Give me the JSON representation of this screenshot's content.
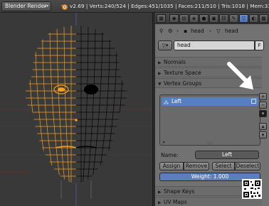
{
  "topbar": {
    "render_engine": "Blender Render",
    "stats": "v2.69 | Verts:240/524 | Edges:451/1035 | Faces:211/510 | Tris:1018 | Mem:33.02M (0.0"
  },
  "props_header": {
    "tabs": [
      "camera-tab",
      "world-tab",
      "object-tab",
      "constraints-tab",
      "modifiers-tab",
      "data-tab",
      "material-tab",
      "texture-tab",
      "particles-tab",
      "physics-tab"
    ]
  },
  "breadcrumb": {
    "object": "head",
    "mesh": "head"
  },
  "mesh_name": {
    "value": "head",
    "fake_user": "F"
  },
  "panels": {
    "normals": "Normals",
    "texture_space": "Texture Space",
    "vertex_groups": "Vertex Groups",
    "shape_keys": "Shape Keys",
    "uv_maps": "UV Maps"
  },
  "vertex_groups": {
    "items": [
      {
        "name": "Left",
        "selected": true
      }
    ]
  },
  "name_row": {
    "label": "Name:",
    "value": "Left"
  },
  "buttons": {
    "assign": "Assign",
    "remove": "Remove",
    "select": "Select",
    "deselect": "Deselect"
  },
  "weight": "Weight: 1.000",
  "colors": {
    "selected_wire": "#f5a020",
    "unselected_wire": "#000000",
    "accent": "#5680c2"
  }
}
